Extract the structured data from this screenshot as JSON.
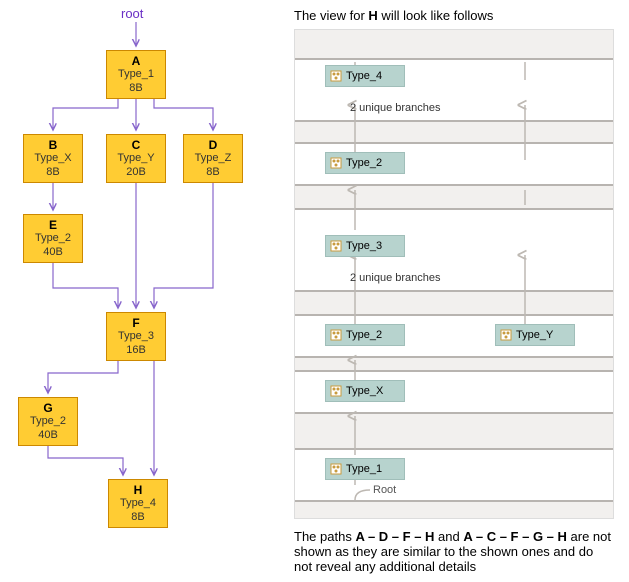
{
  "left_diagram": {
    "root_label": "root",
    "nodes": {
      "A": {
        "name": "A",
        "type": "Type_1",
        "size": "8B"
      },
      "B": {
        "name": "B",
        "type": "Type_X",
        "size": "8B"
      },
      "C": {
        "name": "C",
        "type": "Type_Y",
        "size": "20B"
      },
      "D": {
        "name": "D",
        "type": "Type_Z",
        "size": "8B"
      },
      "E": {
        "name": "E",
        "type": "Type_2",
        "size": "40B"
      },
      "F": {
        "name": "F",
        "type": "Type_3",
        "size": "16B"
      },
      "G": {
        "name": "G",
        "type": "Type_2",
        "size": "40B"
      },
      "H": {
        "name": "H",
        "type": "Type_4",
        "size": "8B"
      }
    }
  },
  "right_view": {
    "caption_prefix": "The view for ",
    "caption_node": "H",
    "caption_suffix": " will look like follows",
    "levels": {
      "top": "Type_4",
      "l2": "Type_2",
      "l3": "Type_3",
      "l4a": "Type_2",
      "l4b": "Type_Y",
      "l5": "Type_X",
      "bottom": "Type_1"
    },
    "branches_text_1": "2 unique branches",
    "branches_text_2": "2 unique branches",
    "root_label": "Root"
  },
  "footnote": {
    "prefix": "The paths ",
    "path1": "A – D – F – H",
    "mid": " and ",
    "path2": "A – C – F – G – H",
    "suffix": " are not shown as they are similar to the shown ones and do not reveal any additional details"
  }
}
